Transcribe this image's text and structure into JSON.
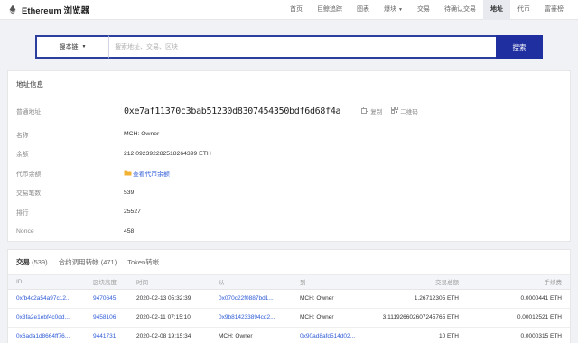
{
  "brand": {
    "title": "Ethereum 浏览器",
    "accent": "#1f2fa0"
  },
  "nav": {
    "items": [
      {
        "label": "首页"
      },
      {
        "label": "巨鲸追踪"
      },
      {
        "label": "图表"
      },
      {
        "label": "爆块"
      },
      {
        "label": "交易"
      },
      {
        "label": "待确认交易"
      },
      {
        "label": "地址"
      },
      {
        "label": "代币"
      },
      {
        "label": "富豪榜"
      }
    ]
  },
  "search": {
    "chain_label": "搜本链",
    "placeholder": "搜索地址、交易、区块",
    "button": "搜索"
  },
  "info": {
    "header": "地址信息",
    "address_label": "普通地址",
    "address": "0xe7af11370c3bab51230d8307454350bdf6d68f4a",
    "copy_label": "复制",
    "qr_label": "二维码",
    "rows": {
      "name_label": "名称",
      "name_value": "MCH: Owner",
      "balance_label": "余额",
      "balance_value": "212.092392282518264399 ETH",
      "token_label": "代币余额",
      "token_value": "查看代币余额",
      "txcount_label": "交易笔数",
      "txcount_value": "539",
      "rank_label": "排行",
      "rank_value": "25527",
      "nonce_label": "Nonce",
      "nonce_value": "458"
    }
  },
  "tabs": [
    {
      "label": "交易",
      "count": "(539)"
    },
    {
      "label": "合约调用转帐",
      "count": "(471)"
    },
    {
      "label": "Token转帐",
      "count": ""
    }
  ],
  "table": {
    "headers": [
      "ID",
      "区块高度",
      "时间",
      "从",
      "到",
      "交易总额",
      "手续费"
    ],
    "rows": [
      [
        "0xfb4c2a54a97c12...",
        "9470645",
        "2020-02-13 05:32:39",
        "0x070c22f0887bd1...",
        "MCH: Owner",
        "1.26712305 ETH",
        "0.0000441 ETH"
      ],
      [
        "0x3fa2e1ebf4c0dd...",
        "9458106",
        "2020-02-11 07:15:10",
        "0x9b814233894cd2...",
        "MCH: Owner",
        "3.111926602607245765 ETH",
        "0.00012521 ETH"
      ],
      [
        "0x6ada1d8664ff76...",
        "9441731",
        "2020-02-08 19:15:34",
        "MCH: Owner",
        "0x90ad8afd514d02...",
        "10 ETH",
        "0.0000315 ETH"
      ]
    ]
  }
}
